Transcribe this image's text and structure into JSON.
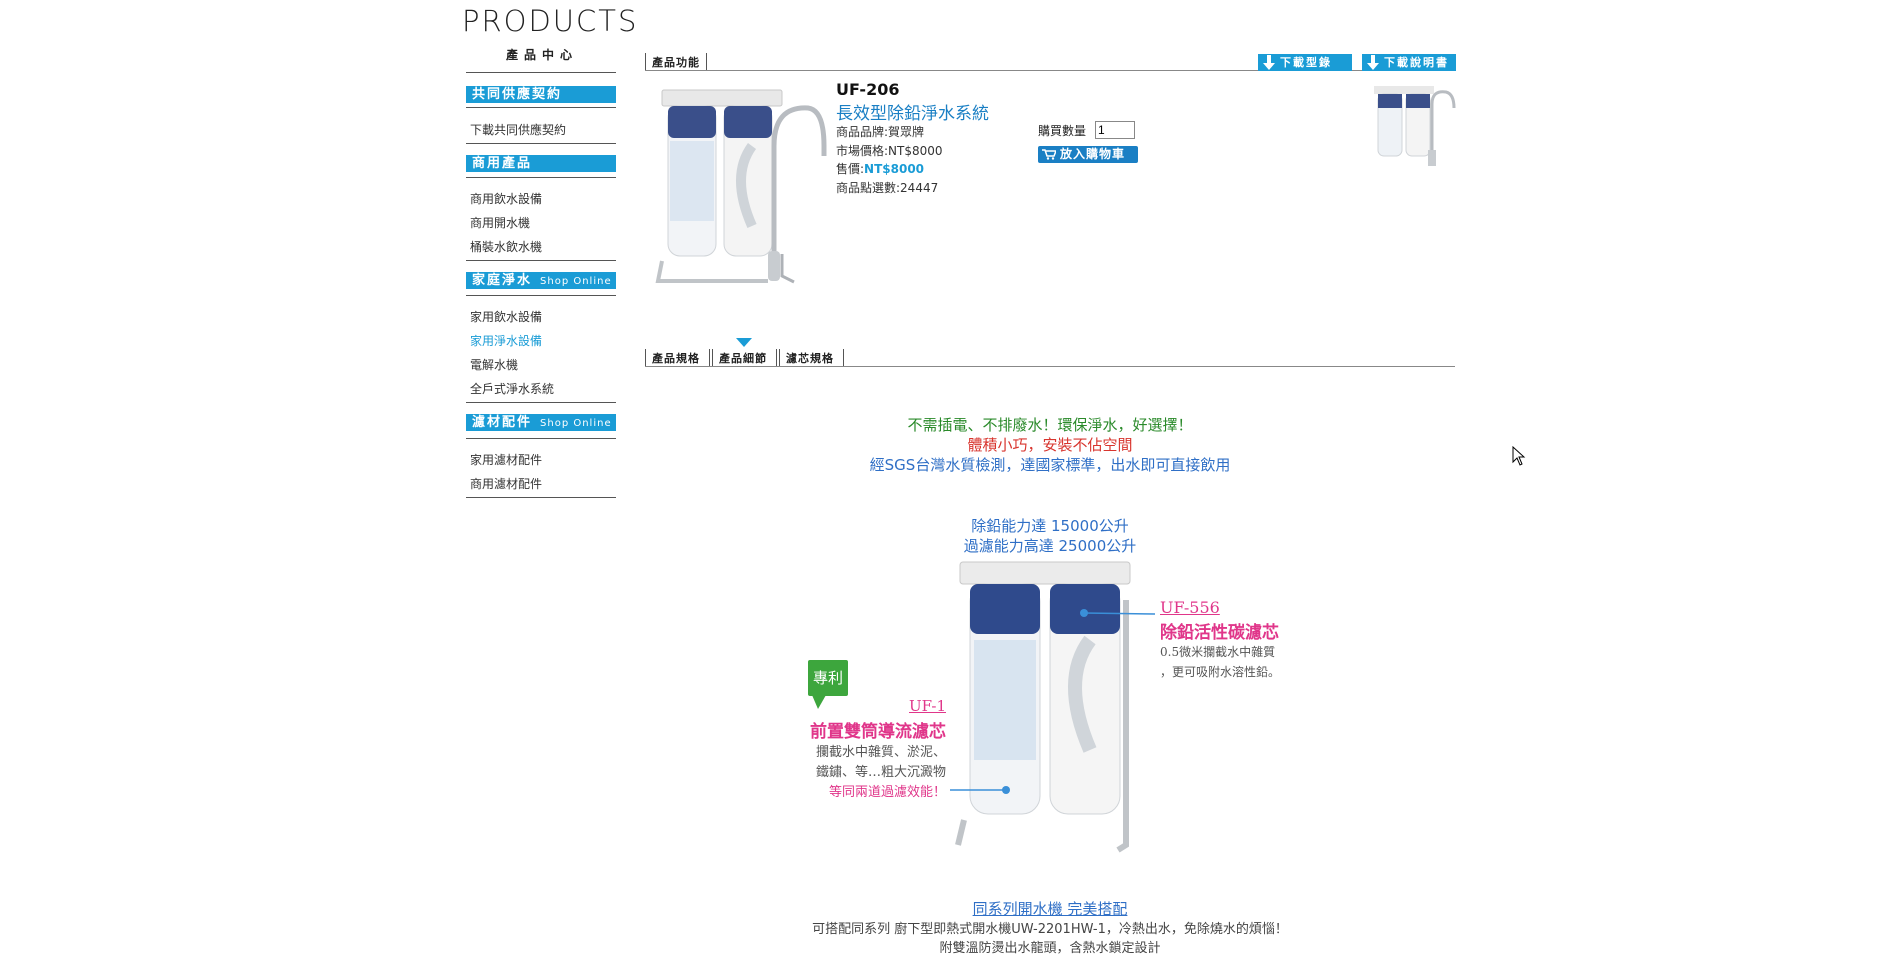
{
  "sidebar": {
    "brand_title": "PRODUCTS",
    "brand_subtitle": "產品中心",
    "sections": [
      {
        "header": "共同供應契約",
        "shop_label": "",
        "items": [
          "下載共同供應契約"
        ]
      },
      {
        "header": "商用產品",
        "shop_label": "",
        "items": [
          "商用飲水設備",
          "商用開水機",
          "桶裝水飲水機"
        ]
      },
      {
        "header": "家庭淨水",
        "shop_label": "Shop Online",
        "items": [
          "家用飲水設備",
          "家用淨水設備",
          "電解水機",
          "全戶式淨水系統"
        ]
      },
      {
        "header": "濾材配件",
        "shop_label": "Shop Online",
        "items": [
          "家用濾材配件",
          "商用濾材配件"
        ]
      }
    ],
    "active_item": "家用淨水設備"
  },
  "top_tab": {
    "label": "產品功能"
  },
  "download_buttons": {
    "catalog": "下載型錄",
    "manual": "下載說明書"
  },
  "product": {
    "code": "UF-206",
    "name": "長效型除鉛淨水系統",
    "brand_line": "商品品牌:賀眾牌",
    "market_price_line": "市場價格:NT$8000",
    "price_prefix": "售價:",
    "price_value": "NT$8000",
    "views_line": "商品點選數:24447",
    "quantity_label": "購買數量",
    "quantity_value": "1",
    "add_to_cart": "放入購物車"
  },
  "detail_tabs": [
    "產品規格",
    "產品細節",
    "濾芯規格"
  ],
  "active_detail_tab": "產品細節",
  "content": {
    "line1": "不需插電、不排廢水！環保淨水，好選擇！",
    "line2": "體積小巧，安裝不佔空間",
    "line3": "經SGS台灣水質檢測，達國家標準，出水即可直接飲用",
    "cap1": "除鉛能力達 15000公升",
    "cap2": "過濾能力高達 25000公升",
    "patent_badge": "專利",
    "uf1_code": "UF-1",
    "uf1_name": "前置雙筒導流濾芯",
    "uf1_desc1": "攔截水中雜質、淤泥、",
    "uf1_desc2": "鐵鏽、等…粗大沉澱物",
    "uf1_desc3": "等同兩道過濾效能！",
    "uf556_code": "UF-556",
    "uf556_name": "除鉛活性碳濾芯",
    "uf556_desc1": "0.5微米攔截水中雜質",
    "uf556_desc2": "，更可吸附水溶性鉛。",
    "series_title": "同系列開水機  完美搭配",
    "series_desc1": "可搭配同系列 廚下型即熱式開水機UW-2201HW-1，冷熱出水，免除燒水的煩惱！",
    "series_desc2": "附雙溫防燙出水龍頭，含熱水鎖定設計"
  },
  "colors": {
    "accent": "#1a9cd6",
    "link": "#1a7fc4",
    "green": "#2a8a2a",
    "red": "#d8352e",
    "pink": "#e0368a"
  }
}
